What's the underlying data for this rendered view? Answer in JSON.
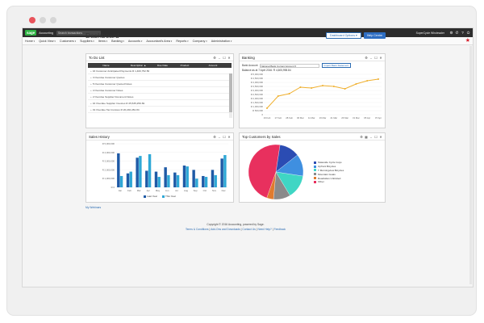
{
  "window": {
    "dots": [
      "#e8535b",
      "#d6d6d6",
      "#d6d6d6"
    ]
  },
  "topbar": {
    "logo": "sage",
    "app_name": "Accounting",
    "search_placeholder": "Search transactions",
    "company": "SuperCycle Wholesaler",
    "icons": [
      "gear-icon",
      "phone-icon",
      "help-icon",
      "power-icon"
    ]
  },
  "menu": {
    "items": [
      "Home",
      "Quick View",
      "Customers",
      "Suppliers",
      "Items",
      "Banking",
      "Accounts",
      "Accountant's Area",
      "Reports",
      "Company",
      "Administration"
    ]
  },
  "page": {
    "title": "Dashboard",
    "options_button": "Dashboard Options",
    "help_button": "Help Centre"
  },
  "todo": {
    "title": "To Do List",
    "columns": [
      "Name",
      "Description ▲",
      "Due Date",
      "Product",
      "Amount"
    ],
    "items": [
      "16 Customer Anticipated Payments R 1,400,752.56",
      "3 Overdue Customer Quotes",
      "5 Overdue Customer Quoted Notes",
      "4 Overdue Customer Notes",
      "2 Overdue Supplier Document Notes",
      "16 Overdue Supplier Invoices R 25,535,259.69",
      "19 Overdue Tax Invoices R 20,240,281.84"
    ]
  },
  "banking": {
    "title": "Banking",
    "account_label": "Bank Account",
    "account_value": "National Bank Current Account",
    "import_button": "Import Bank Statement",
    "balance_text": "Balance as at 7 April 2016: R 4,605,998.84"
  },
  "sales": {
    "title": "Sales History",
    "legend": [
      "Last Year",
      "This Year"
    ]
  },
  "top_customers": {
    "title": "Top Customers by Sales",
    "legend": [
      "Stateside Cycle Guys",
      "Upfront Bicycles",
      "T Morningview Bicycles",
      "Mountain Goats",
      "Roadsides Unlimited",
      "Other"
    ]
  },
  "chart_data": [
    {
      "type": "line",
      "x": [
        "16 Feb",
        "17 Feb",
        "28 Feb",
        "06 Mar",
        "11 Mar",
        "16 Mar",
        "21 Mar",
        "26 Mar",
        "31 Mar",
        "05 Apr",
        "07 Apr"
      ],
      "series": [
        {
          "values": [
            800000,
            2300000,
            2600000,
            3400000,
            3300000,
            3600000,
            3500000,
            3200000,
            3800000,
            4200000,
            4400000
          ]
        }
      ],
      "ylim": [
        0,
        5000000
      ],
      "yticks": [
        "0",
        "R 500,000",
        "R 1,000,000",
        "R 1,500,000",
        "R 2,000,000",
        "R 2,500,000",
        "R 3,000,000",
        "R 3,500,000",
        "R 4,000,000",
        "R 4,500,000",
        "R 5,000,000"
      ],
      "color": "#f0b02f"
    },
    {
      "type": "bar",
      "categories": [
        "Jan",
        "Feb",
        "Mar",
        "Apr",
        "May",
        "Jun",
        "Jul",
        "Aug",
        "Sep",
        "Oct",
        "Nov",
        "Dec"
      ],
      "series": [
        {
          "name": "Last Year",
          "color": "#1f5aa6",
          "values": [
            3900000,
            1600000,
            3400000,
            1900000,
            1800000,
            2300000,
            1700000,
            2500000,
            2000000,
            1300000,
            2000000,
            3300000
          ]
        },
        {
          "name": "This Year",
          "color": "#2fa8d6",
          "values": [
            1300000,
            1800000,
            3600000,
            3800000,
            1200000,
            1400000,
            1400000,
            2400000,
            1000000,
            1200000,
            1400000,
            3700000
          ]
        }
      ],
      "ylim": [
        0,
        5000000
      ],
      "yticks": [
        "R 0",
        "R 1,000,000",
        "R 2,000,000",
        "R 3,000,000",
        "R 4,000,000",
        "R 5,000,000"
      ]
    },
    {
      "type": "pie",
      "labels": [
        "Stateside Cycle Guys",
        "Upfront Bicycles",
        "T Morningview Bicycles",
        "Mountain Goats",
        "Roadsides Unlimited",
        "Other"
      ],
      "values": [
        12,
        13,
        14,
        10,
        4,
        47
      ],
      "colors": [
        "#2b4cb3",
        "#3f8fe0",
        "#3fd6c4",
        "#8a8a8a",
        "#e07b2f",
        "#e8305e"
      ]
    }
  ],
  "footer": {
    "web_link": "My Webinars",
    "copyright": "Copyright © 2016 Accounting, powered by Sage.",
    "links": [
      "Terms & Conditions",
      "Add-Ons and Downloads",
      "Contact Us",
      "Need Help?",
      "Feedback"
    ]
  }
}
